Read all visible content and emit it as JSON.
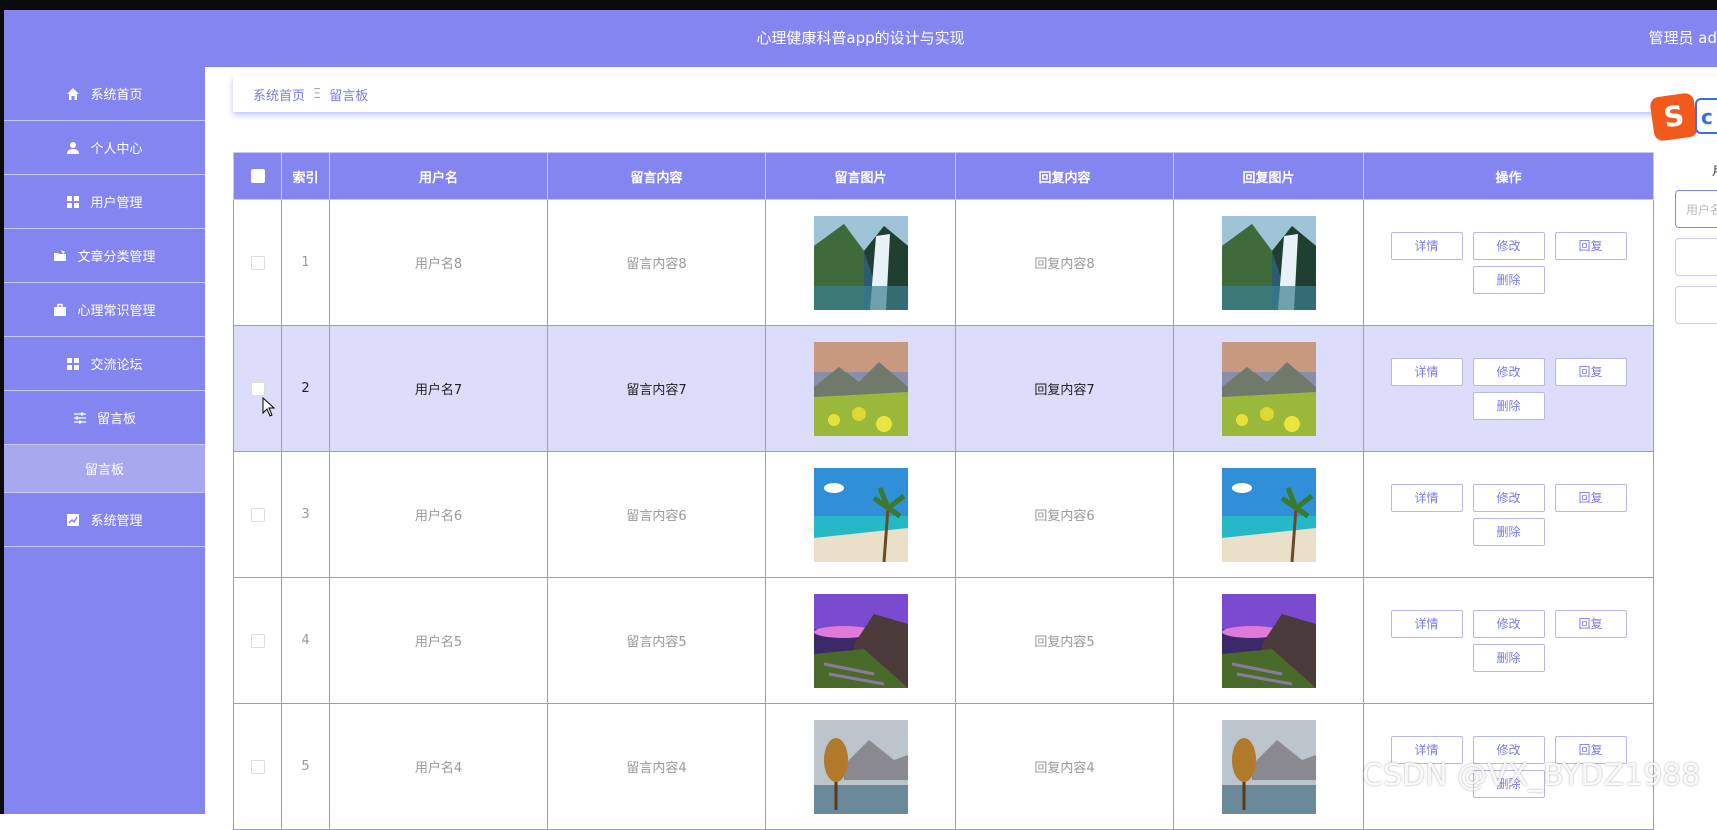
{
  "header": {
    "title": "心理健康科普app的设计与实现",
    "user": "管理员 ad"
  },
  "sidebar": {
    "items": [
      {
        "label": "系统首页",
        "icon": "home-icon"
      },
      {
        "label": "个人中心",
        "icon": "person-icon"
      },
      {
        "label": "用户管理",
        "icon": "grid-icon"
      },
      {
        "label": "文章分类管理",
        "icon": "folder-icon"
      },
      {
        "label": "心理常识管理",
        "icon": "briefcase-icon"
      },
      {
        "label": "交流论坛",
        "icon": "grid-icon"
      },
      {
        "label": "留言板",
        "icon": "sliders-icon"
      },
      {
        "label": "留言板",
        "icon": null,
        "sub": true
      },
      {
        "label": "系统管理",
        "icon": "chart-icon"
      }
    ]
  },
  "breadcrumb": {
    "home": "系统首页",
    "sep": "Ξ",
    "current": "留言板"
  },
  "search": {
    "label": "月",
    "placeholder": "用户名"
  },
  "table": {
    "columns": [
      "",
      "索引",
      "用户名",
      "留言内容",
      "留言图片",
      "回复内容",
      "回复图片",
      "操作"
    ],
    "rows": [
      {
        "index": "1",
        "username": "用户名8",
        "content": "留言内容8",
        "reply": "回复内容8",
        "image": "waterfall"
      },
      {
        "index": "2",
        "username": "用户名7",
        "content": "留言内容7",
        "reply": "回复内容7",
        "image": "meadow"
      },
      {
        "index": "3",
        "username": "用户名6",
        "content": "留言内容6",
        "reply": "回复内容6",
        "image": "beach"
      },
      {
        "index": "4",
        "username": "用户名5",
        "content": "留言内容5",
        "reply": "回复内容5",
        "image": "coast"
      },
      {
        "index": "5",
        "username": "用户名4",
        "content": "留言内容4",
        "reply": "回复内容4",
        "image": "lake"
      }
    ],
    "actions": {
      "detail": "详情",
      "edit": "修改",
      "reply": "回复",
      "delete": "删除"
    }
  },
  "watermark": "CSDN @VX_BYDZ1988",
  "colors": {
    "primary": "#8585f2",
    "highlight_row": "#dcdcfb",
    "button_text": "#7b7bea"
  }
}
